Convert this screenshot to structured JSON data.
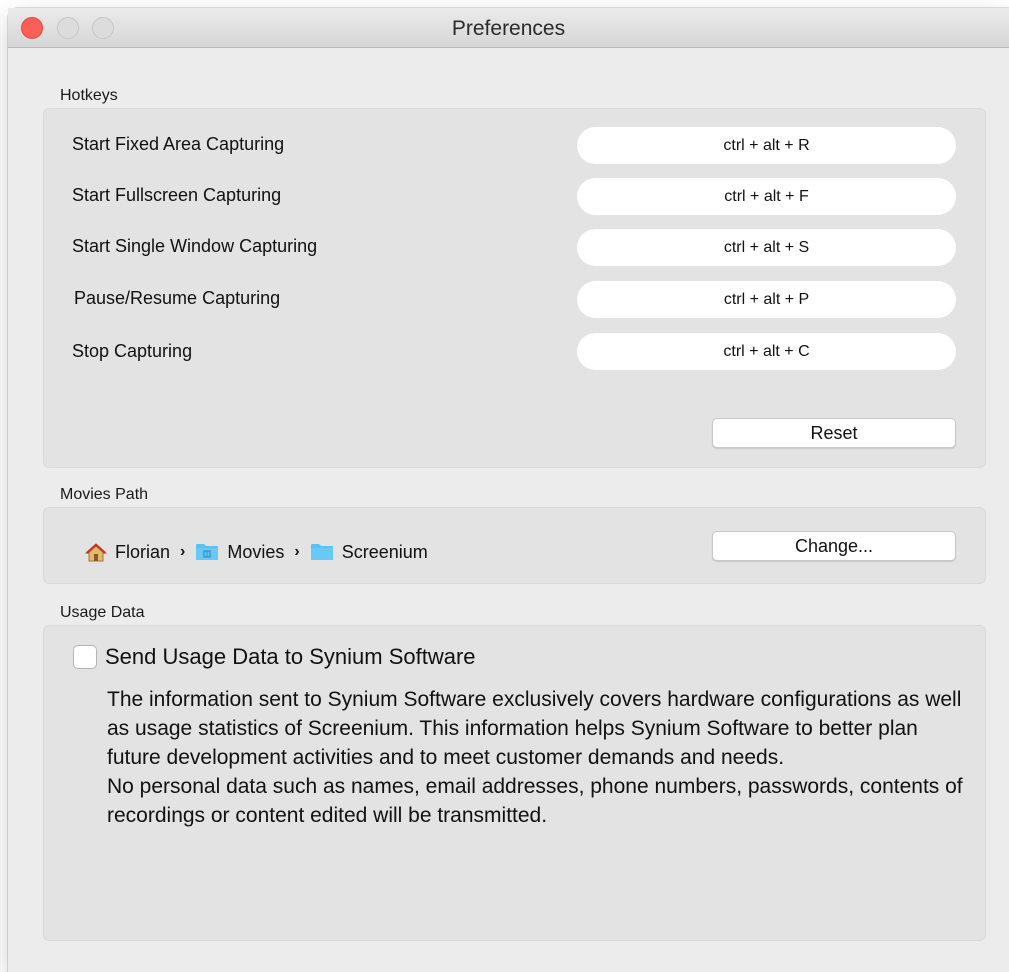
{
  "window": {
    "title": "Preferences"
  },
  "hotkeys": {
    "section_label": "Hotkeys",
    "items": [
      {
        "label": "Start Fixed Area Capturing",
        "shortcut": "ctrl + alt + R"
      },
      {
        "label": "Start Fullscreen Capturing",
        "shortcut": "ctrl + alt + F"
      },
      {
        "label": "Start Single Window Capturing",
        "shortcut": "ctrl + alt + S"
      },
      {
        "label": "Pause/Resume Capturing",
        "shortcut": "ctrl + alt + P"
      },
      {
        "label": "Stop Capturing",
        "shortcut": "ctrl + alt + C"
      }
    ],
    "reset_label": "Reset"
  },
  "movies_path": {
    "section_label": "Movies Path",
    "segments": [
      {
        "name": "Florian",
        "icon": "home-icon"
      },
      {
        "name": "Movies",
        "icon": "movies-folder-icon"
      },
      {
        "name": "Screenium",
        "icon": "folder-icon"
      }
    ],
    "change_label": "Change..."
  },
  "usage": {
    "section_label": "Usage Data",
    "checkbox_label": "Send Usage Data to Synium Software",
    "checked": false,
    "paragraph1": "The information sent to Synium Software exclusively covers hardware configurations as well as usage statistics of Screenium. This information helps Synium Software to better plan future development activities and to meet customer demands and needs.",
    "paragraph2": "No personal data such as names, email addresses, phone numbers, passwords, contents of recordings or content edited will be transmitted."
  },
  "colors": {
    "close_button": "#fc5f57",
    "folder_blue": "#5ac1f3"
  }
}
